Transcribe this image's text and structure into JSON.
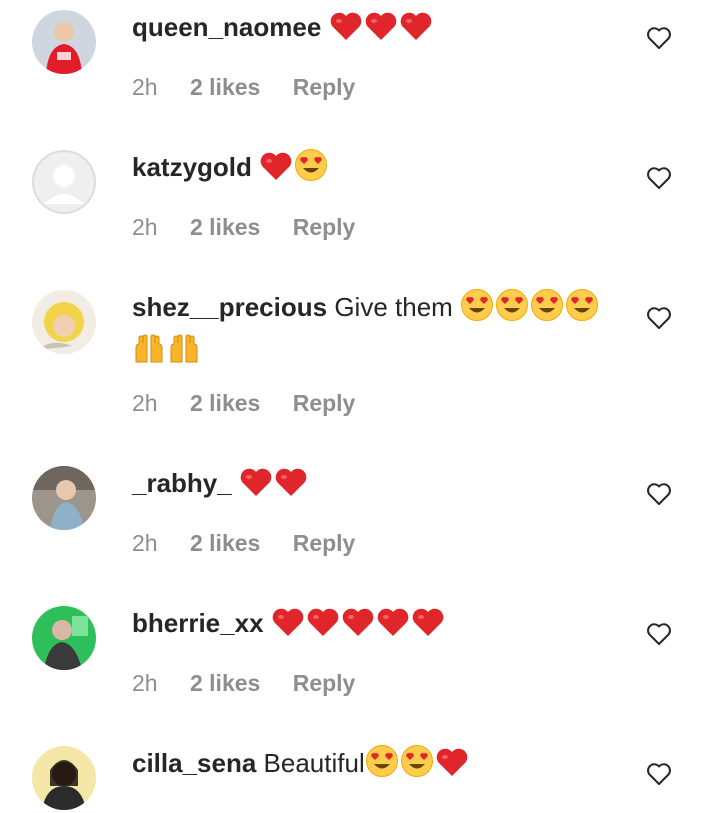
{
  "comments": [
    {
      "username": "queen_naomee",
      "text": "",
      "emojis": [
        "heart",
        "heart",
        "heart"
      ],
      "time": "2h",
      "likes": "2 likes",
      "reply": "Reply",
      "avatar": "avatar-red-shirt"
    },
    {
      "username": "katzygold",
      "text": "",
      "emojis": [
        "heart",
        "heart-eyes"
      ],
      "time": "2h",
      "likes": "2 likes",
      "reply": "Reply",
      "avatar": "default-avatar"
    },
    {
      "username": "shez__precious",
      "text": "Give them",
      "emojis": [
        "heart-eyes",
        "heart-eyes",
        "heart-eyes",
        "heart-eyes",
        "raised-hands",
        "raised-hands"
      ],
      "time": "2h",
      "likes": "2 likes",
      "reply": "Reply",
      "avatar": "avatar-baby-yellow"
    },
    {
      "username": "_rabhy_",
      "text": "",
      "emojis": [
        "heart",
        "heart"
      ],
      "time": "2h",
      "likes": "2 likes",
      "reply": "Reply",
      "avatar": "avatar-child"
    },
    {
      "username": "bherrie_xx",
      "text": "",
      "emojis": [
        "heart",
        "heart",
        "heart",
        "heart",
        "heart"
      ],
      "time": "2h",
      "likes": "2 likes",
      "reply": "Reply",
      "avatar": "avatar-green"
    },
    {
      "username": "cilla_sena",
      "text": "Beautiful",
      "emojis": [
        "heart-eyes",
        "heart-eyes",
        "heart"
      ],
      "time": "",
      "likes": "",
      "reply": "",
      "avatar": "avatar-woman"
    }
  ],
  "colors": {
    "meta": "#8e8e8e",
    "text": "#262626",
    "heart": "#e0252b"
  }
}
